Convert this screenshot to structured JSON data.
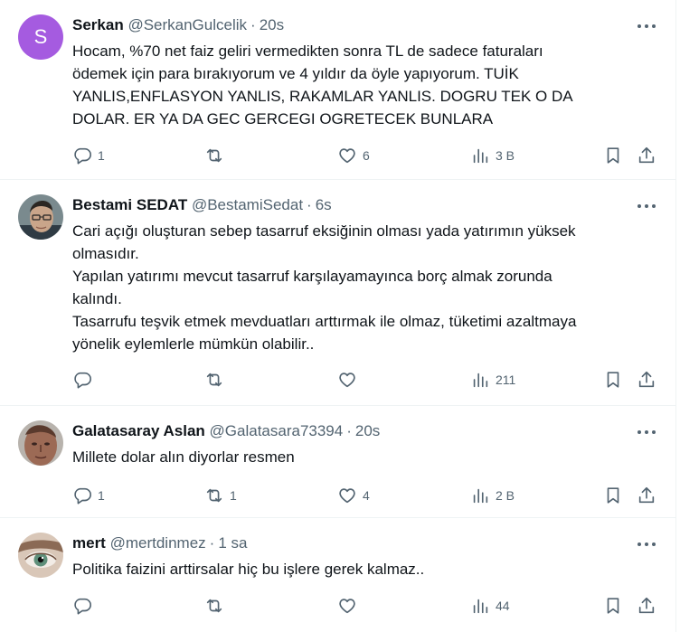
{
  "tweets": [
    {
      "avatar_letter": "S",
      "avatar_color": "#a55be0",
      "name": "Serkan",
      "handle": "@SerkanGulcelik",
      "separator": "·",
      "time": "20s",
      "text": "Hocam, %70 net faiz geliri vermedikten sonra TL de sadece faturaları\nödemek için para bırakıyorum ve 4 yıldır da öyle yapıyorum. TUİK\nYANLIS,ENFLASYON YANLIS, RAKAMLAR YANLIS. DOGRU TEK O DA\nDOLAR. ER YA DA GEC GERCEGI OGRETECEK BUNLARA",
      "replies": "1",
      "retweets": "",
      "likes": "6",
      "views": "3 B"
    },
    {
      "name": "Bestami SEDAT",
      "handle": "@BestamiSedat",
      "separator": "·",
      "time": "6s",
      "text": "Cari açığı oluşturan sebep tasarruf eksiğinin olması yada yatırımın yüksek\nolmasıdır.\nYapılan yatırımı mevcut tasarruf karşılayamayınca borç almak zorunda\nkalındı.\nTasarrufu teşvik etmek mevduatları arttırmak ile olmaz, tüketimi azaltmaya\nyönelik eylemlerle mümkün olabilir..",
      "replies": "",
      "retweets": "",
      "likes": "",
      "views": "211"
    },
    {
      "name": "Galatasaray Aslan",
      "handle": "@Galatasara73394",
      "separator": "·",
      "time": "20s",
      "text": "Millete dolar alın diyorlar resmen",
      "replies": "1",
      "retweets": "1",
      "likes": "4",
      "views": "2 B"
    },
    {
      "name": "mert",
      "handle": "@mertdinmez",
      "separator": "·",
      "time": "1 sa",
      "text": "Politika faizini arttirsalar hiç bu işlere gerek kalmaz..",
      "replies": "",
      "retweets": "",
      "likes": "",
      "views": "44"
    }
  ]
}
